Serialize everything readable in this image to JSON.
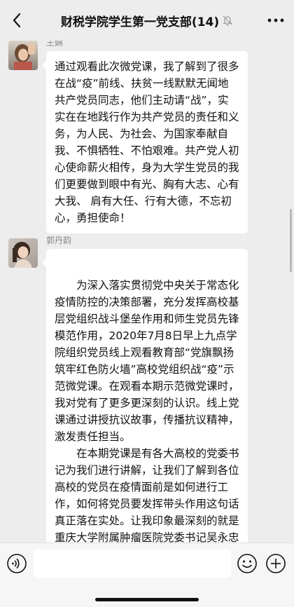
{
  "header": {
    "title": "财税学院学生第一党支部(14)",
    "back_icon": "chevron-left-icon",
    "mute_icon": "bell-off-icon",
    "more_icon": "more-dots-icon"
  },
  "messages": [
    {
      "sender": "王娴",
      "paragraphs": [
        "通过观看此次微党课，我了解到了很多在战“疫”前线、扶贫一线默默无闻地共产党员同志，他们主动请“战”，实实在在地践行作为共产党员的责任和义务，为人民、为社会、为国家奉献自我、不惧牺牲、不怕艰难。共产党人初心使命薪火相传，身为大学生党员的我们更要做到眼中有光、胸有大志、心有大我、 肩有大任、行有大德，不忘初心，勇担使命！"
      ]
    },
    {
      "sender": "郭丹韵",
      "paragraphs": [
        "为深入落实贯彻党中央关于常态化疫情防控的决策部署，充分发挥高校基层党组织战斗堡垒作用和师生党员先锋模范作用，2020年7月8日早上九点学院组织党员线上观看教育部“党旗飘扬 筑牢红色防火墙”高校党组织战“疫”示范微党课。在观看本期示范微党课时，我对党有了更多更深刻的认识。线上党课通过讲授抗议故事，传播抗议精神，激发责任担当。",
        "在本期党课是有各大高校的党委书记为我们进行讲解，让我们了解到各位高校的党员在疫情面前是如何进行工作，如何将党员要发挥带头作用这句话真正落在实处。让我印象最深刻的就是重庆大学附属肿瘤医院党委书记吴永忠老师的讲话，他的演讲以“打起防控责任"
      ]
    }
  ],
  "input": {
    "value": "",
    "voice_icon": "voice-icon",
    "emoji_icon": "emoji-icon",
    "plus_icon": "plus-icon"
  },
  "colors": {
    "background": "#ededed",
    "bubble": "#ffffff",
    "sender_name": "#888888"
  }
}
